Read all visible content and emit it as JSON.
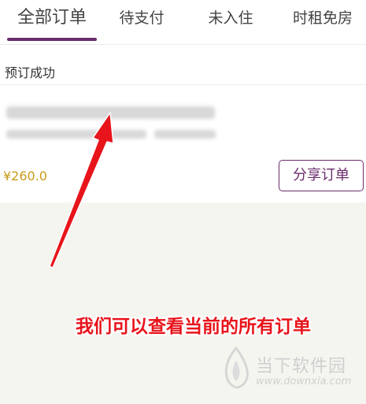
{
  "tabs": [
    {
      "label": "全部订单",
      "active": true
    },
    {
      "label": "待支付",
      "active": false
    },
    {
      "label": "未入住",
      "active": false
    },
    {
      "label": "时租免房",
      "active": false
    }
  ],
  "order": {
    "status": "预订成功",
    "price": "¥260.0",
    "share_label": "分享订单"
  },
  "annotation": "我们可以查看当前的所有订单",
  "watermark": {
    "name": "当下软件园",
    "url": "www.downxia.com"
  },
  "colors": {
    "accent": "#6b2d6e",
    "price": "#c89a1a",
    "annotation": "#e8141b"
  }
}
